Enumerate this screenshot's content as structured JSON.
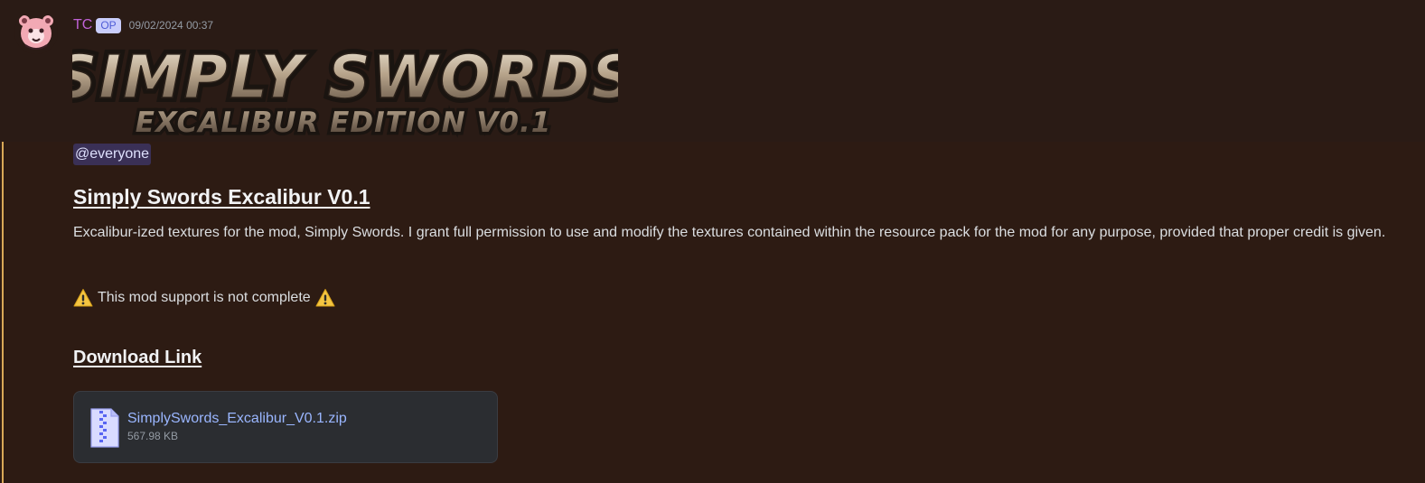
{
  "message": {
    "author": "TC",
    "badge": "OP",
    "timestamp": "09/02/2024 00:37",
    "mention": "@everyone",
    "title": "Simply Swords Excalibur V0.1",
    "description": "Excalibur-ized textures for the mod, Simply Swords. I grant full permission to use and modify the textures contained within the resource pack for the mod for any purpose, provided that proper credit is given.",
    "warning": "This mod support is not complete",
    "download_heading": "Download Link"
  },
  "banner": {
    "line1": "SIMPLY SWORDS",
    "line2": "EXCALIBUR EDITION V0.1"
  },
  "attachment": {
    "file_name": "SimplySwords_Excalibur_V0.1.zip",
    "file_size": "567.98 KB",
    "icon": "zip-file-icon"
  },
  "colors": {
    "author": "#c062d6",
    "badge_bg": "#c9cdfb",
    "mention_bar": "#d9a857",
    "link": "#9ab6ff",
    "warning": "#f4c542"
  }
}
